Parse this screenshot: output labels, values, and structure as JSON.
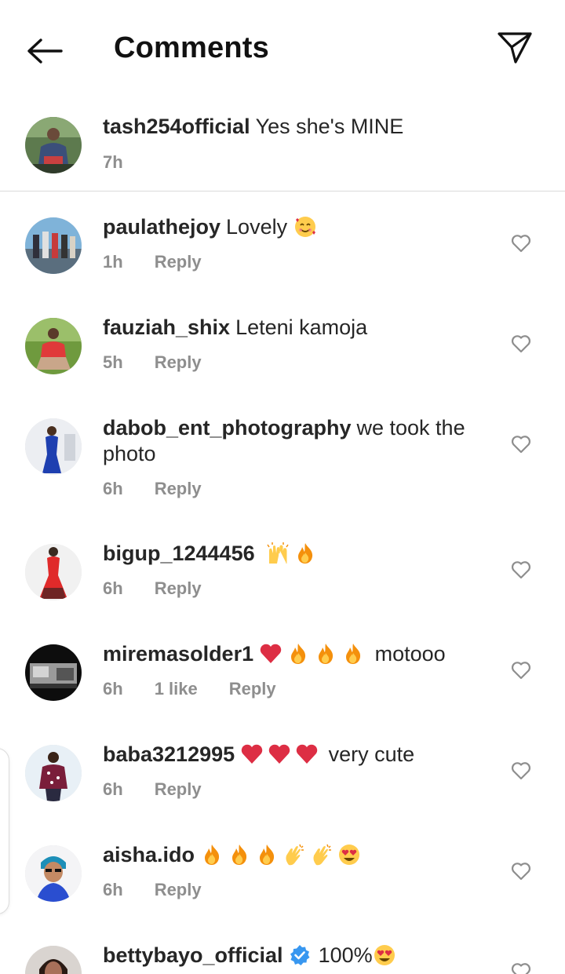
{
  "header": {
    "title": "Comments"
  },
  "caption": {
    "username": "tash254official",
    "text": "Yes she's MINE",
    "time": "7h"
  },
  "comments": [
    {
      "username": "paulathejoy",
      "text": "Lovely",
      "emojis": [
        "smiling-face-with-hearts"
      ],
      "time": "1h",
      "likes": "",
      "reply": "Reply"
    },
    {
      "username": "fauziah_shix",
      "text": "Leteni kamoja",
      "emojis": [],
      "time": "5h",
      "likes": "",
      "reply": "Reply"
    },
    {
      "username": "dabob_ent_photography",
      "text": "we took the photo",
      "emojis": [],
      "time": "6h",
      "likes": "",
      "reply": "Reply"
    },
    {
      "username": "bigup_1244456",
      "text": "",
      "emojis": [
        "raising-hands",
        "fire"
      ],
      "time": "6h",
      "likes": "",
      "reply": "Reply"
    },
    {
      "username": "miremasolder1",
      "text": "motooo",
      "emojis": [
        "red-heart",
        "fire",
        "fire",
        "fire"
      ],
      "time": "6h",
      "likes": "1 like",
      "reply": "Reply"
    },
    {
      "username": "baba3212995",
      "text": "very cute",
      "emojis": [
        "red-heart",
        "red-heart",
        "red-heart"
      ],
      "time": "6h",
      "likes": "",
      "reply": "Reply"
    },
    {
      "username": "aisha.ido",
      "text": "",
      "emojis": [
        "fire",
        "fire",
        "fire",
        "clapping-hands",
        "clapping-hands",
        "heart-eyes"
      ],
      "time": "6h",
      "likes": "",
      "reply": "Reply"
    },
    {
      "username": "bettybayo_official",
      "text": "100%",
      "emojis": [
        "verified-badge",
        "heart-eyes"
      ],
      "time": "",
      "likes": "",
      "reply": ""
    }
  ],
  "colors": {
    "text": "#262626",
    "meta": "#8e8e8e",
    "divider": "#dbdbdb",
    "verified": "#3897f0",
    "heart_emoji": "#dd2e44",
    "fire_emoji": "#f4900c"
  },
  "icons": [
    "back-arrow-icon",
    "send-icon",
    "heart-outline-icon",
    "verified-icon"
  ]
}
